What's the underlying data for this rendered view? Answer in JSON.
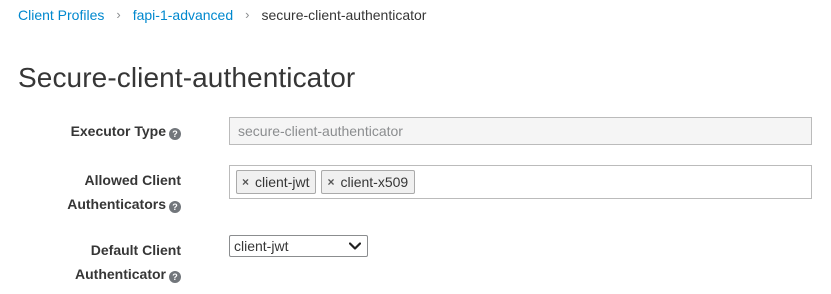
{
  "breadcrumb": {
    "items": [
      {
        "label": "Client Profiles"
      },
      {
        "label": "fapi-1-advanced"
      },
      {
        "label": "secure-client-authenticator"
      }
    ],
    "separator": "›"
  },
  "page": {
    "title": "Secure-client-authenticator"
  },
  "form": {
    "executor_type": {
      "label": "Executor Type",
      "value": "secure-client-authenticator"
    },
    "allowed_client_authenticators": {
      "label_line1": "Allowed Client",
      "label_line2": "Authenticators",
      "tags": [
        {
          "label": "client-jwt",
          "remove": "×"
        },
        {
          "label": "client-x509",
          "remove": "×"
        }
      ]
    },
    "default_client_authenticator": {
      "label_line1": "Default Client",
      "label_line2": "Authenticator",
      "selected": "client-jwt"
    },
    "help_glyph": "?"
  },
  "colors": {
    "link": "#0088ce",
    "text": "#363636",
    "help_icon": "#72767b",
    "readonly_bg": "#f5f5f5",
    "border": "#bbbbbb"
  },
  "icons": [
    "help-icon",
    "remove-tag-icon",
    "chevron-down-icon"
  ]
}
